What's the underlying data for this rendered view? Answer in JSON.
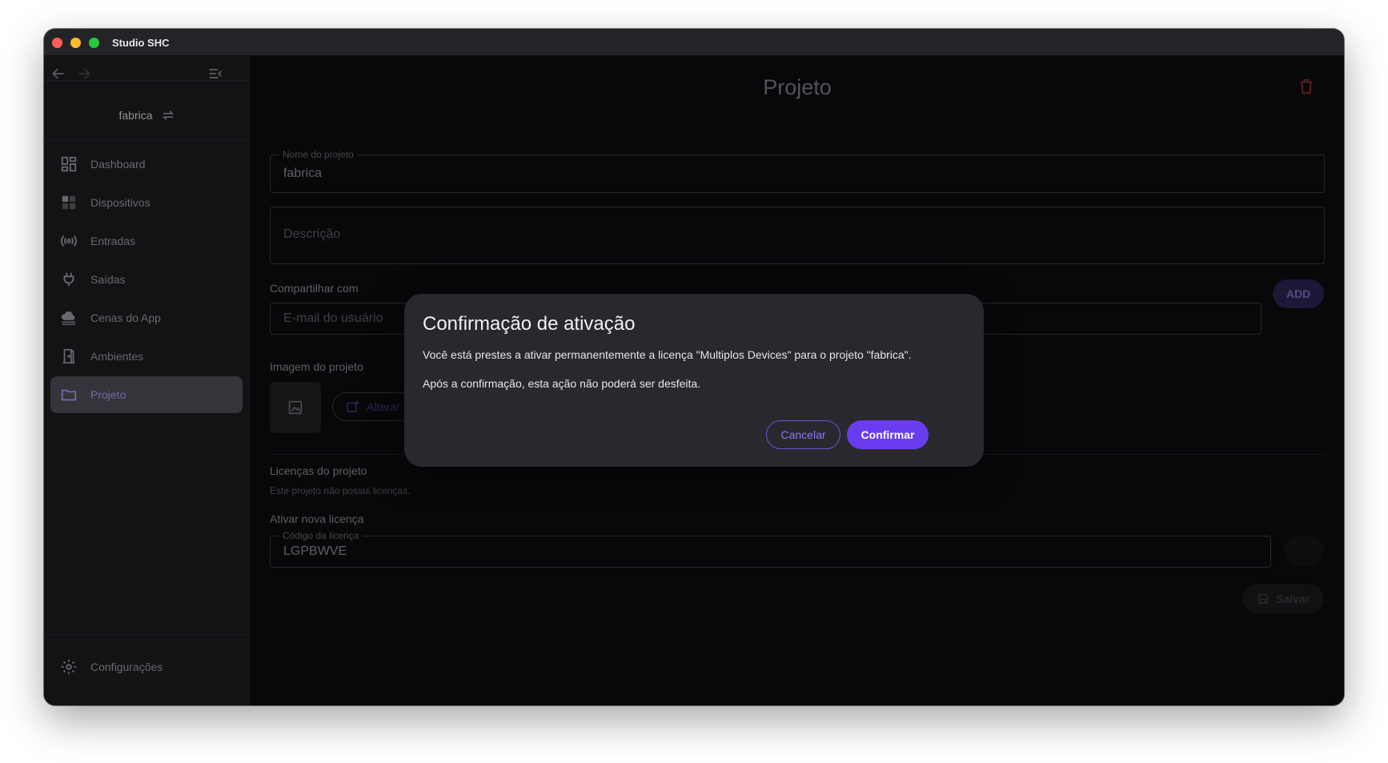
{
  "window": {
    "title": "Studio SHC"
  },
  "sidebar": {
    "project_name": "fabrica",
    "items": [
      {
        "label": "Dashboard",
        "icon": "dashboard-icon"
      },
      {
        "label": "Dispositivos",
        "icon": "devices-icon"
      },
      {
        "label": "Entradas",
        "icon": "sensors-icon"
      },
      {
        "label": "Saídas",
        "icon": "plug-icon"
      },
      {
        "label": "Cenas do App",
        "icon": "cloud-icon"
      },
      {
        "label": "Ambientes",
        "icon": "door-icon"
      },
      {
        "label": "Projeto",
        "icon": "folder-icon",
        "active": true
      }
    ],
    "settings_label": "Configurações"
  },
  "main": {
    "title": "Projeto",
    "name_field": {
      "legend": "Nome do projeto",
      "value": "fabrica"
    },
    "description_field": {
      "placeholder": "Descrição"
    },
    "share": {
      "label": "Compartilhar com",
      "placeholder": "E-mail do usuário",
      "add_label": "ADD"
    },
    "image": {
      "label": "Imagem do projeto",
      "change_label": "Alterar"
    },
    "licenses": {
      "label": "Licenças do projeto",
      "empty_text": "Este projeto não possui licenças."
    },
    "activate": {
      "label": "Ativar nova licença",
      "legend": "Código da licença",
      "value": "LGPBWVE"
    },
    "save_label": "Salvar"
  },
  "dialog": {
    "title": "Confirmação de ativação",
    "line1": "Você está prestes a ativar permanentemente a licença \"Multiplos Devices\" para o projeto \"fabrica\".",
    "line2": "Após a confirmação, esta ação não poderá ser desfeita.",
    "cancel_label": "Cancelar",
    "confirm_label": "Confirmar"
  },
  "colors": {
    "accent": "#6a3cf0",
    "danger": "#8a3033",
    "background": "#0d0d0f"
  }
}
